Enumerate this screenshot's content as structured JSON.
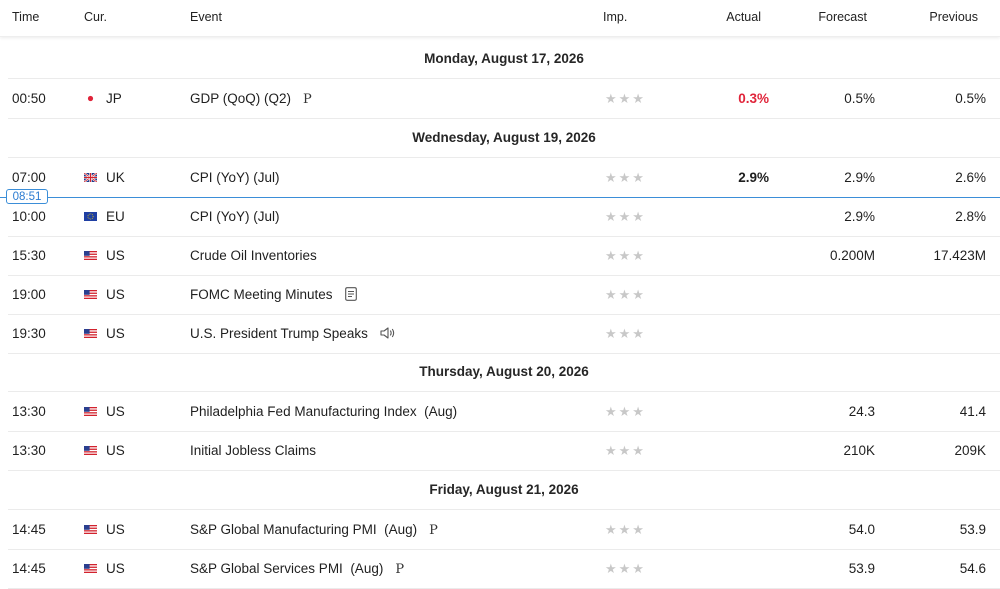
{
  "header": {
    "time": "Time",
    "cur": "Cur.",
    "event": "Event",
    "imp": "Imp.",
    "actual": "Actual",
    "forecast": "Forecast",
    "previous": "Previous"
  },
  "now_marker": "08:51",
  "colors": {
    "accent_blue": "#3b8ed8",
    "actual_red": "#e0243a",
    "star_gray": "#c8c8c8"
  },
  "days": [
    {
      "label": "Monday, August 17, 2026",
      "events": [
        {
          "time": "00:50",
          "flag": "jp-flag-icon",
          "currency": "JP",
          "event": "GDP (QoQ) (Q2)",
          "badge": "P",
          "actual": "0.3%",
          "forecast": "0.5%",
          "previous": "0.5%"
        }
      ]
    },
    {
      "label": "Wednesday, August 19, 2026",
      "events": [
        {
          "time": "07:00",
          "flag": "uk-flag-icon",
          "currency": "UK",
          "event": "CPI (YoY) (Jul)",
          "actual": "2.9%",
          "forecast": "2.9%",
          "previous": "2.6%"
        },
        {
          "time": "10:00",
          "flag": "eu-flag-icon",
          "currency": "EU",
          "event": "CPI (YoY) (Jul)",
          "actual": "",
          "forecast": "2.9%",
          "previous": "2.8%"
        },
        {
          "time": "15:30",
          "flag": "us-flag-icon",
          "currency": "US",
          "event": "Crude Oil Inventories",
          "actual": "",
          "forecast": "0.200M",
          "previous": "17.423M"
        },
        {
          "time": "19:00",
          "flag": "us-flag-icon",
          "currency": "US",
          "event": "FOMC Meeting Minutes",
          "icon": "document-icon",
          "actual": "",
          "forecast": "",
          "previous": ""
        },
        {
          "time": "19:30",
          "flag": "us-flag-icon",
          "currency": "US",
          "event": "U.S. President Trump Speaks",
          "icon": "speaker-icon",
          "actual": "",
          "forecast": "",
          "previous": ""
        }
      ]
    },
    {
      "label": "Thursday, August 20, 2026",
      "events": [
        {
          "time": "13:30",
          "flag": "us-flag-icon",
          "currency": "US",
          "event": "Philadelphia Fed Manufacturing Index  (Aug)",
          "actual": "",
          "forecast": "24.3",
          "previous": "41.4"
        },
        {
          "time": "13:30",
          "flag": "us-flag-icon",
          "currency": "US",
          "event": "Initial Jobless Claims",
          "actual": "",
          "forecast": "210K",
          "previous": "209K"
        }
      ]
    },
    {
      "label": "Friday, August 21, 2026",
      "events": [
        {
          "time": "14:45",
          "flag": "us-flag-icon",
          "currency": "US",
          "event": "S&P Global Manufacturing PMI  (Aug)",
          "badge": "P",
          "actual": "",
          "forecast": "54.0",
          "previous": "53.9"
        },
        {
          "time": "14:45",
          "flag": "us-flag-icon",
          "currency": "US",
          "event": "S&P Global Services PMI  (Aug)",
          "badge": "P",
          "actual": "",
          "forecast": "53.9",
          "previous": "54.6"
        }
      ]
    }
  ]
}
